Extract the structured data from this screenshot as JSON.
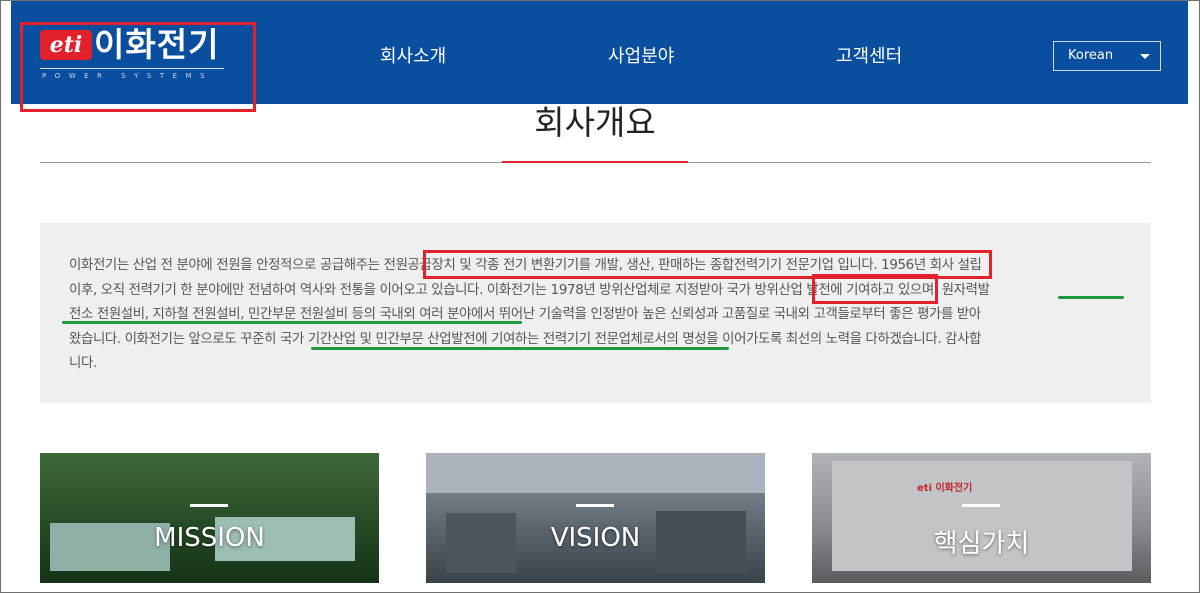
{
  "header": {
    "logo": {
      "badge": "eti",
      "name": "이화전기",
      "subtitle": "POWER SYSTEMS"
    },
    "nav": [
      "회사소개",
      "사업분야",
      "고객센터"
    ],
    "language": "Korean"
  },
  "page": {
    "title": "회사개요"
  },
  "intro": {
    "lines": [
      "이화전기는 산업 전 분야에 전원을 안정적으로 공급해주는 전원공급장치 및 각종 전기 변환기기를 개발, 생산, 판매하는 종합전력기기 전문기업 입니다. 1956년 회사 설립",
      "이후, 오직 전력기기 한 분야에만 전념하여 역사와 전통을 이어오고 있습니다. 이화전기는 1978년 방위산업체로 지정받아 국가 방위산업 발전에 기여하고 있으며, 원자력발",
      "전소 전원설비, 지하철 전원설비, 민간부문 전원설비 등의 국내외 여러 분야에서 뛰어난 기술력을 인정받아 높은 신뢰성과 고품질로 국내외 고객들로부터 좋은 평가를 받아",
      "왔습니다. 이화전기는 앞으로도 꾸준히 국가 기간산업 및 민간부문 산업발전에 기여하는 전력기기 전문업체로서의 명성을 이어가도록 최선의 노력을 다하겠습니다. 감사합",
      "니다."
    ]
  },
  "cards": [
    {
      "label": "MISSION"
    },
    {
      "label": "VISION"
    },
    {
      "label": "핵심가치",
      "sign": "eti 이화전기"
    }
  ],
  "colors": {
    "header_bg": "#0a4f9f",
    "highlight_red": "#e3212d",
    "underline_green": "#1e9a3c",
    "intro_bg": "#efefef"
  }
}
